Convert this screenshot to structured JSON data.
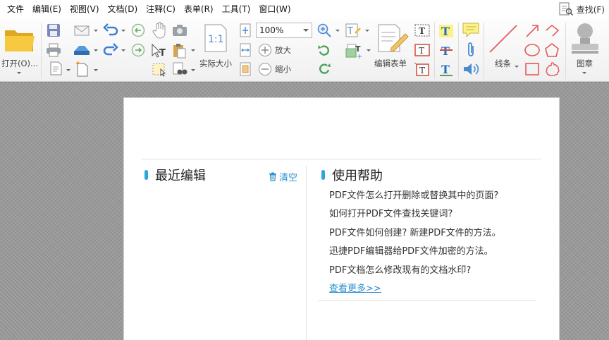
{
  "menubar": {
    "items": [
      "文件",
      "编辑(E)",
      "视图(V)",
      "文档(D)",
      "注释(C)",
      "表单(R)",
      "工具(T)",
      "窗口(W)"
    ],
    "find_label": "查找(F)"
  },
  "toolbar": {
    "open_label": "打开(O)...",
    "zoom_value": "100%",
    "actual_size_label": "实际大小",
    "zoom_in_label": "放大",
    "zoom_out_label": "缩小",
    "edit_form_label": "编辑表单",
    "line_label": "线条",
    "stamp_label": "图章"
  },
  "recent": {
    "title": "最近编辑",
    "clear_label": "清空"
  },
  "help": {
    "title": "使用帮助",
    "items": [
      "PDF文件怎么打开删除或替换其中的页面?",
      "如何打开PDF文件查找关键词?",
      "PDF文件如何创建? 新建PDF文件的方法。",
      "迅捷PDF编辑器给PDF文件加密的方法。",
      "PDF文档怎么修改现有的文档水印?"
    ],
    "more_label": "查看更多>>"
  },
  "colors": {
    "accent": "#2da6dc",
    "link": "#2c8fd0"
  }
}
